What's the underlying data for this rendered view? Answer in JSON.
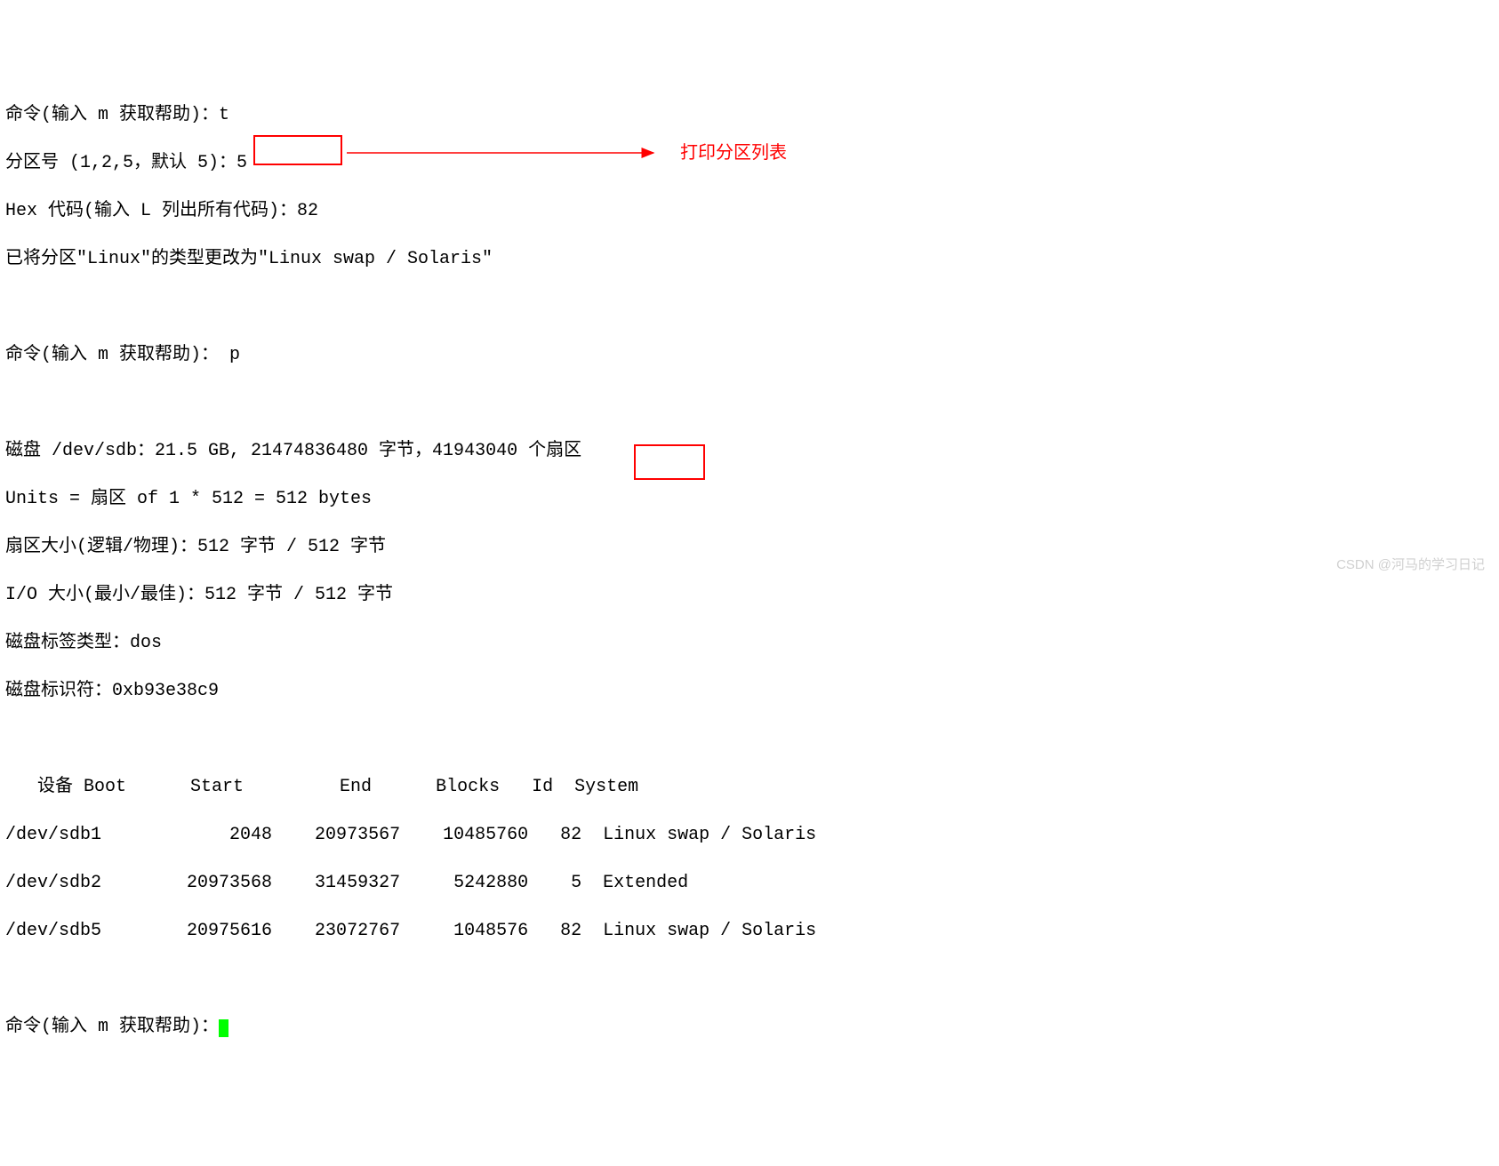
{
  "lines": {
    "l1_prompt": "命令(输入 m 获取帮助)：",
    "l1_input": "t",
    "l2_prompt": "分区号 (1,2,5，默认 5)：",
    "l2_input": "5",
    "l3_prompt": "Hex 代码(输入 L 列出所有代码)：",
    "l3_input": "82",
    "l4": "已将分区\"Linux\"的类型更改为\"Linux swap / Solaris\"",
    "l5_prompt": "命令(输入 m 获取帮助)：",
    "l5_input": " p",
    "l6": "磁盘 /dev/sdb：21.5 GB, 21474836480 字节，41943040 个扇区",
    "l7": "Units = 扇区 of 1 * 512 = 512 bytes",
    "l8": "扇区大小(逻辑/物理)：512 字节 / 512 字节",
    "l9": "I/O 大小(最小/最佳)：512 字节 / 512 字节",
    "l10": "磁盘标签类型：dos",
    "l11": "磁盘标识符：0xb93e38c9",
    "header": "   设备 Boot      Start         End      Blocks   Id  System",
    "row1": "/dev/sdb1            2048    20973567    10485760   82  Linux swap / Solaris",
    "row2": "/dev/sdb2        20973568    31459327     5242880    5  Extended",
    "row3": "/dev/sdb5        20975616    23072767     1048576   82  Linux swap / Solaris",
    "last_prompt": "命令(输入 m 获取帮助)："
  },
  "annotation": "打印分区列表",
  "watermark": "CSDN @河马的学习日记"
}
